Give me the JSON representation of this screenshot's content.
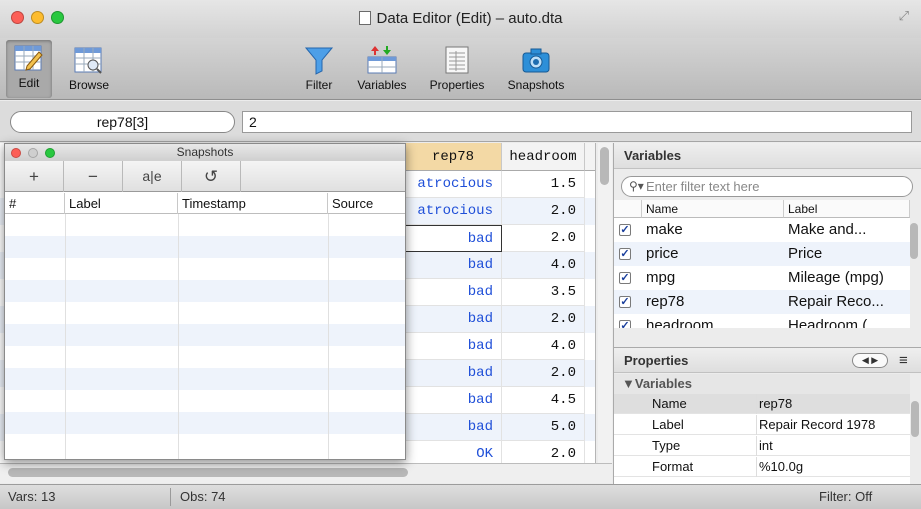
{
  "window": {
    "title": "Data Editor (Edit) – auto.dta"
  },
  "toolbar": {
    "edit": "Edit",
    "browse": "Browse",
    "filter": "Filter",
    "variables": "Variables",
    "properties": "Properties",
    "snapshots": "Snapshots"
  },
  "command": {
    "cell_ref": "rep78[3]",
    "cell_value": "2"
  },
  "grid": {
    "columns": [
      "rep78",
      "headroom"
    ],
    "rows": [
      [
        "atrocious",
        "1.5"
      ],
      [
        "atrocious",
        "2.0"
      ],
      [
        "bad",
        "2.0"
      ],
      [
        "bad",
        "4.0"
      ],
      [
        "bad",
        "3.5"
      ],
      [
        "bad",
        "2.0"
      ],
      [
        "bad",
        "4.0"
      ],
      [
        "bad",
        "2.0"
      ],
      [
        "bad",
        "4.5"
      ],
      [
        "bad",
        "5.0"
      ],
      [
        "OK",
        "2.0"
      ]
    ]
  },
  "snapshots": {
    "title": "Snapshots",
    "buttons": {
      "add": "+",
      "remove": "−",
      "rename": "a|e",
      "restore": "↺"
    },
    "columns": [
      "#",
      "Label",
      "Timestamp",
      "Source"
    ]
  },
  "variables_panel": {
    "title": "Variables",
    "filter_placeholder": "Enter filter text here",
    "columns": [
      "Name",
      "Label"
    ],
    "rows": [
      {
        "name": "make",
        "label": "Make and...",
        "checked": true
      },
      {
        "name": "price",
        "label": "Price",
        "checked": true
      },
      {
        "name": "mpg",
        "label": "Mileage (mpg)",
        "checked": true
      },
      {
        "name": "rep78",
        "label": "Repair Reco...",
        "checked": true
      },
      {
        "name": "headroom",
        "label": "Headroom (",
        "checked": true
      }
    ]
  },
  "properties_panel": {
    "title": "Properties",
    "group": "▼Variables",
    "rows": [
      {
        "key": "Name",
        "value": "rep78"
      },
      {
        "key": "Label",
        "value": "Repair Record 1978"
      },
      {
        "key": "Type",
        "value": "int"
      },
      {
        "key": "Format",
        "value": "%10.0g"
      }
    ]
  },
  "status": {
    "vars": "Vars: 13",
    "obs": "Obs: 74",
    "filter": "Filter: Off"
  },
  "colors": {
    "value_label_blue": "#1f4fd8",
    "selected_col_header": "#f5dba6",
    "zebra": "#eef3fb"
  }
}
